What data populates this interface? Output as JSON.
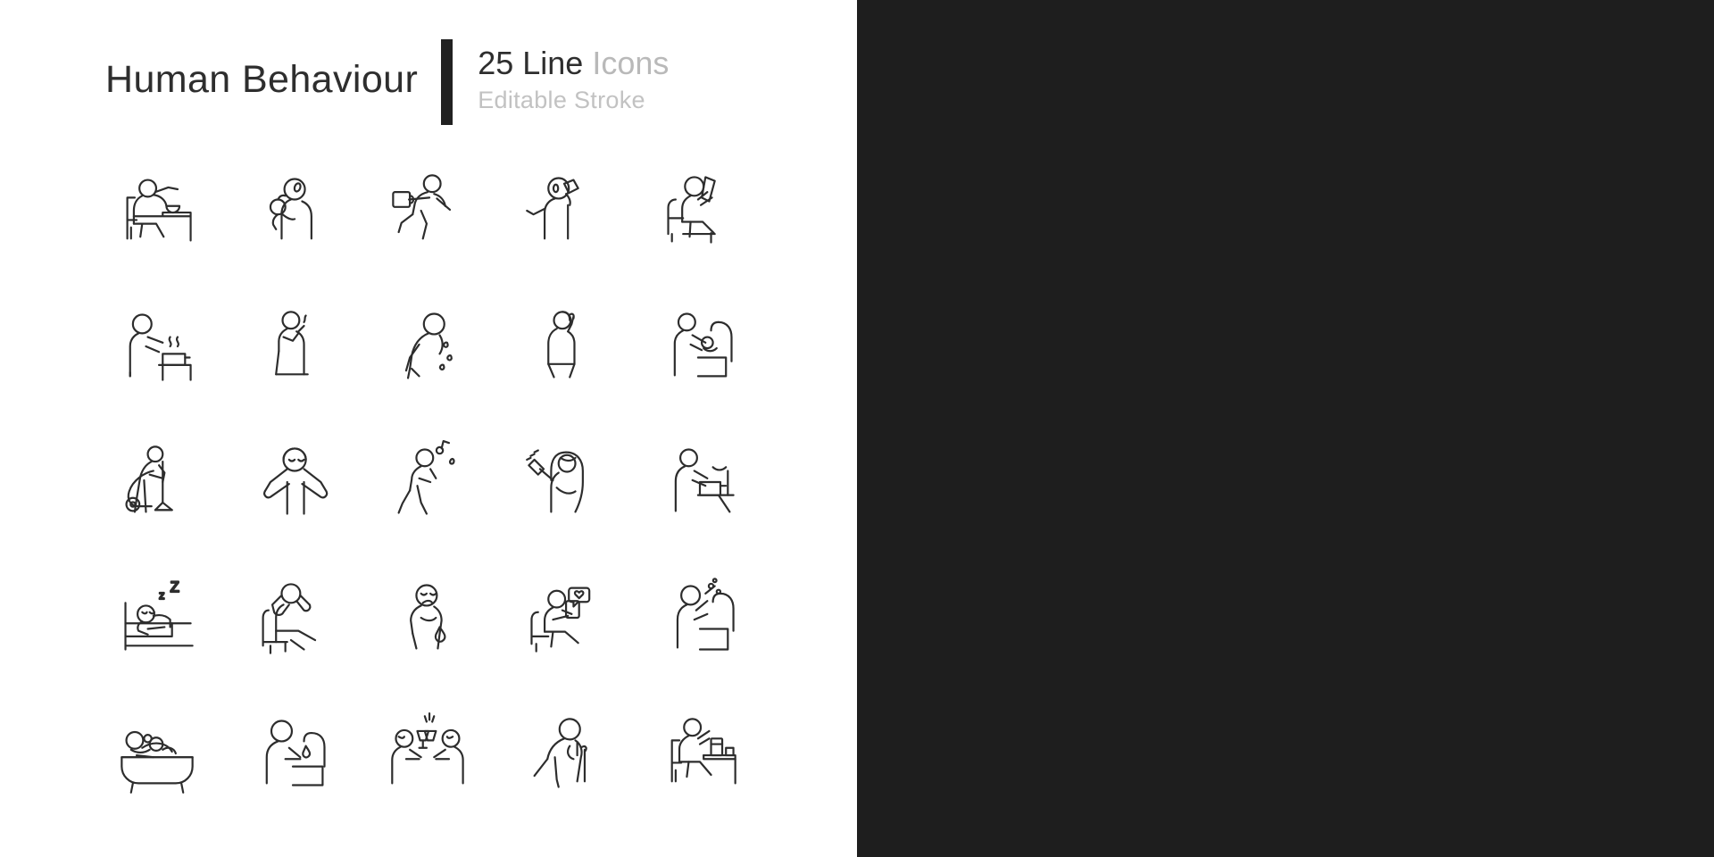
{
  "meta": {
    "panels": [
      "light",
      "dark"
    ],
    "columns": 5,
    "rows": 5,
    "light_background": "#ffffff",
    "dark_background": "#1e1e1e",
    "light_stroke": "#2d2d2d",
    "dark_stroke": "#ffffff"
  },
  "header": {
    "title": "Human Behaviour",
    "count_and_type": "25 Line",
    "icons_word": " Icons",
    "editable": "Editable Stroke"
  },
  "icons": [
    {
      "id": 1,
      "name": "eating-meal-at-table",
      "label": "Eating meal at table"
    },
    {
      "id": 2,
      "name": "eating-apple",
      "label": "Eating apple"
    },
    {
      "id": 3,
      "name": "running-with-coffee",
      "label": "Running with coffee"
    },
    {
      "id": 4,
      "name": "drinking-from-bottle",
      "label": "Drinking from bottle"
    },
    {
      "id": 5,
      "name": "reading-book-in-chair",
      "label": "Reading book in armchair"
    },
    {
      "id": 6,
      "name": "cooking-on-stove",
      "label": "Cooking on stove"
    },
    {
      "id": 7,
      "name": "smoking-cigarette",
      "label": "Smoking cigarette"
    },
    {
      "id": 8,
      "name": "sweating-exhausted",
      "label": "Sweating and exhausted"
    },
    {
      "id": 9,
      "name": "woman-talking-on-phone",
      "label": "Woman talking on phone"
    },
    {
      "id": 10,
      "name": "feeding-baby",
      "label": "Feeding baby"
    },
    {
      "id": 11,
      "name": "vacuum-cleaning",
      "label": "Vacuum cleaning"
    },
    {
      "id": 12,
      "name": "listening-headphones",
      "label": "Listening with headphones"
    },
    {
      "id": 13,
      "name": "walking-with-music",
      "label": "Walking and listening to music"
    },
    {
      "id": 14,
      "name": "brushing-hair",
      "label": "Brushing hair"
    },
    {
      "id": 15,
      "name": "washing-dishes",
      "label": "Washing dishes"
    },
    {
      "id": 16,
      "name": "sleeping-in-bed",
      "label": "Sleeping in bed"
    },
    {
      "id": 17,
      "name": "relaxing-in-chair",
      "label": "Relaxing in chair"
    },
    {
      "id": 18,
      "name": "crying-sad",
      "label": "Crying, feeling sad"
    },
    {
      "id": 19,
      "name": "using-phone-social",
      "label": "Using phone on social media"
    },
    {
      "id": 20,
      "name": "brushing-teeth",
      "label": "Brushing teeth at sink"
    },
    {
      "id": 21,
      "name": "taking-bath",
      "label": "Taking a bath"
    },
    {
      "id": 22,
      "name": "washing-hands",
      "label": "Washing hands"
    },
    {
      "id": 23,
      "name": "toasting-drinks",
      "label": "Toasting drinks together"
    },
    {
      "id": 24,
      "name": "elderly-with-cane",
      "label": "Elderly person with cane"
    },
    {
      "id": 25,
      "name": "working-at-desk",
      "label": "Working at desk"
    }
  ],
  "sleep_icon": {
    "z_small": "z",
    "z_large": "Z"
  }
}
